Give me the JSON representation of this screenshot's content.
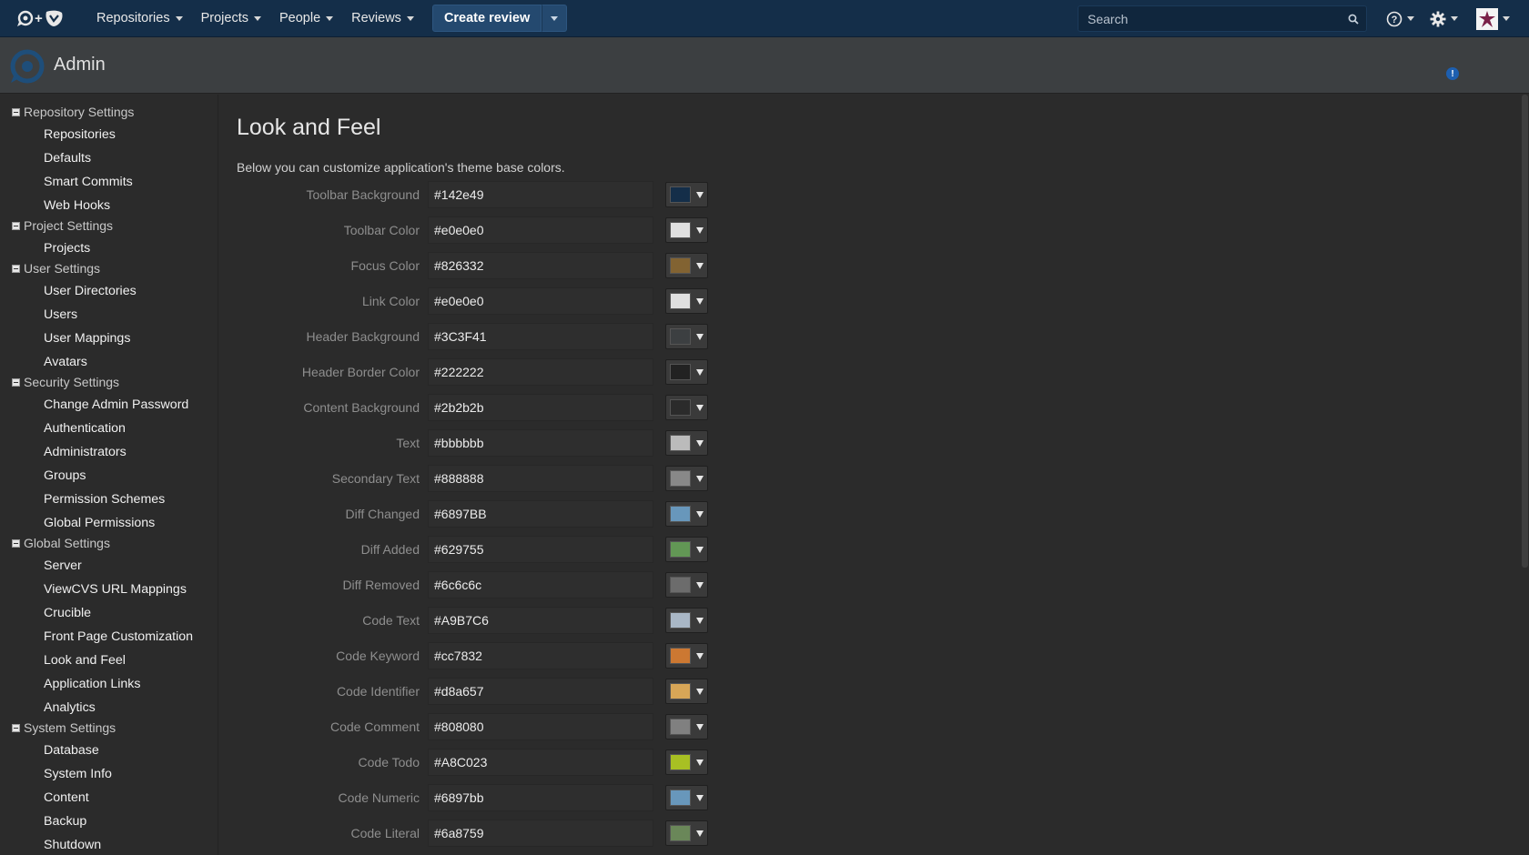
{
  "toolbar": {
    "nav": [
      {
        "label": "Repositories"
      },
      {
        "label": "Projects"
      },
      {
        "label": "People"
      },
      {
        "label": "Reviews"
      }
    ],
    "create_label": "Create review",
    "search_placeholder": "Search",
    "icons": [
      "fisheye-crucible-logo-icon",
      "search-icon",
      "help-icon",
      "gear-icon",
      "user-avatar-icon"
    ]
  },
  "header": {
    "title": "Admin",
    "notification": "!"
  },
  "sidebar": {
    "sections": [
      {
        "title": "Repository Settings",
        "items": [
          "Repositories",
          "Defaults",
          "Smart Commits",
          "Web Hooks"
        ]
      },
      {
        "title": "Project Settings",
        "items": [
          "Projects"
        ]
      },
      {
        "title": "User Settings",
        "items": [
          "User Directories",
          "Users",
          "User Mappings",
          "Avatars"
        ]
      },
      {
        "title": "Security Settings",
        "items": [
          "Change Admin Password",
          "Authentication",
          "Administrators",
          "Groups",
          "Permission Schemes",
          "Global Permissions"
        ]
      },
      {
        "title": "Global Settings",
        "items": [
          "Server",
          "ViewCVS URL Mappings",
          "Crucible",
          "Front Page Customization",
          "Look and Feel",
          "Application Links",
          "Analytics"
        ]
      },
      {
        "title": "System Settings",
        "items": [
          "Database",
          "System Info",
          "Content",
          "Backup",
          "Shutdown"
        ]
      }
    ]
  },
  "content": {
    "title": "Look and Feel",
    "description": "Below you can customize application's theme base colors.",
    "colors": [
      {
        "label": "Toolbar Background",
        "value": "#142e49"
      },
      {
        "label": "Toolbar Color",
        "value": "#e0e0e0"
      },
      {
        "label": "Focus Color",
        "value": "#826332"
      },
      {
        "label": "Link Color",
        "value": "#e0e0e0"
      },
      {
        "label": "Header Background",
        "value": "#3C3F41"
      },
      {
        "label": "Header Border Color",
        "value": "#222222"
      },
      {
        "label": "Content Background",
        "value": "#2b2b2b"
      },
      {
        "label": "Text",
        "value": "#bbbbbb"
      },
      {
        "label": "Secondary Text",
        "value": "#888888"
      },
      {
        "label": "Diff Changed",
        "value": "#6897BB"
      },
      {
        "label": "Diff Added",
        "value": "#629755"
      },
      {
        "label": "Diff Removed",
        "value": "#6c6c6c"
      },
      {
        "label": "Code Text",
        "value": "#A9B7C6"
      },
      {
        "label": "Code Keyword",
        "value": "#cc7832"
      },
      {
        "label": "Code Identifier",
        "value": "#d8a657"
      },
      {
        "label": "Code Comment",
        "value": "#808080"
      },
      {
        "label": "Code Todo",
        "value": "#A8C023"
      },
      {
        "label": "Code Numeric",
        "value": "#6897bb"
      },
      {
        "label": "Code Literal",
        "value": "#6a8759"
      }
    ]
  }
}
